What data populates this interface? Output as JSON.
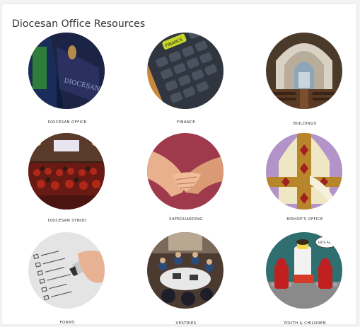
{
  "header": {
    "title": "Diocesan Office Resources"
  },
  "tiles": [
    {
      "label": "DIOCESAN OFFICE",
      "icon": "office-sign-icon"
    },
    {
      "label": "FINANCE",
      "icon": "calculator-icon"
    },
    {
      "label": "BUILDINGS",
      "icon": "church-interior-icon"
    },
    {
      "label": "DIOCESAN SYNOD",
      "icon": "audience-icon"
    },
    {
      "label": "SAFEGUARDING",
      "icon": "hands-icon"
    },
    {
      "label": "BISHOP'S OFFICE",
      "icon": "mitre-icon"
    },
    {
      "label": "FORMS",
      "icon": "form-icon"
    },
    {
      "label": "VESTRIES",
      "icon": "meeting-icon"
    },
    {
      "label": "YOUTH & CHILDREN",
      "icon": "lego-figures-icon"
    }
  ],
  "images": {
    "office_sign_text": "DIOCESAN OFFICE",
    "calculator_key": "FINANCE",
    "lego_speech": "HE'S ALIVE!"
  }
}
